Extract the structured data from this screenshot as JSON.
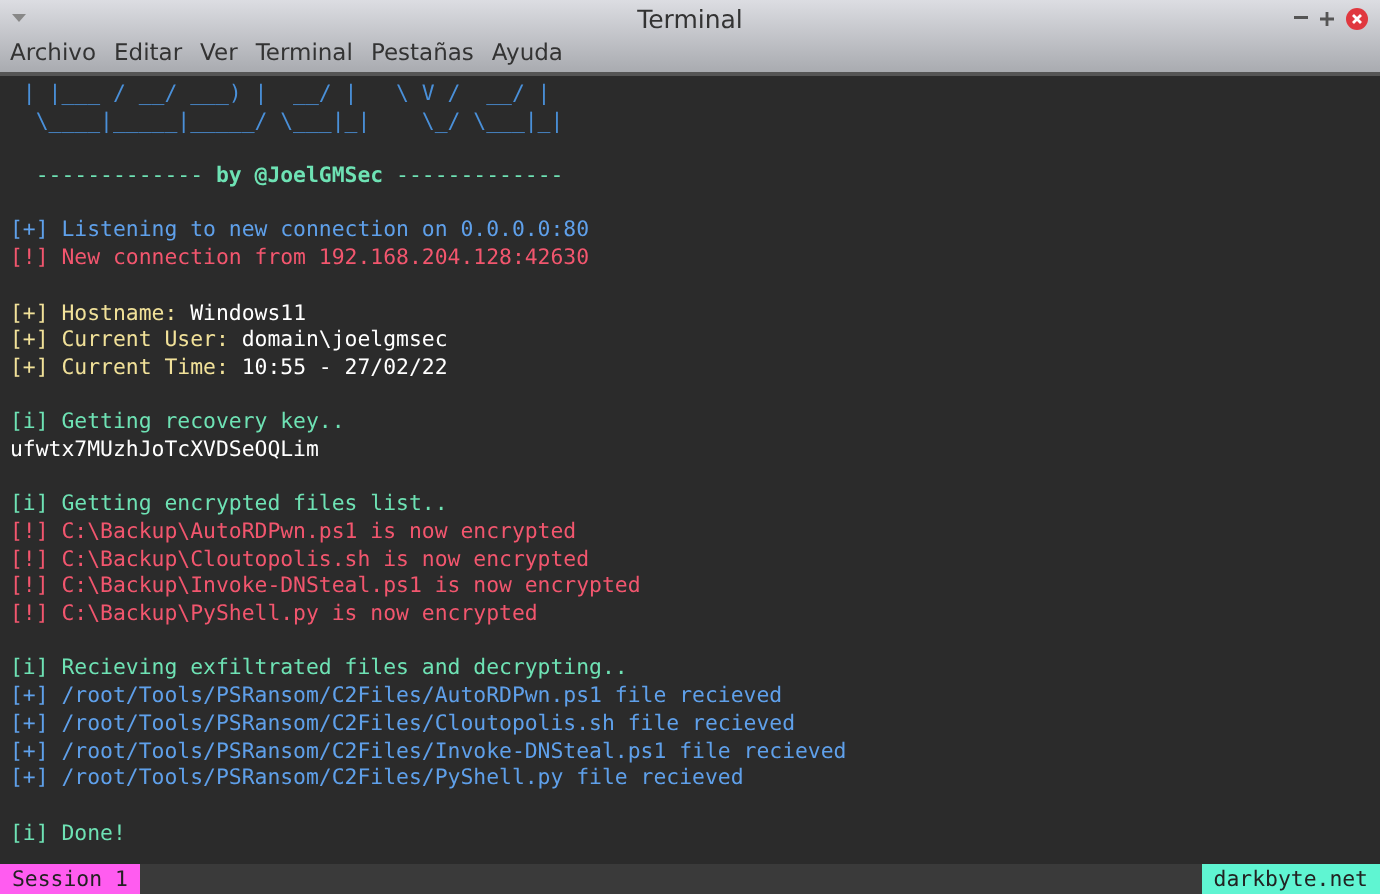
{
  "window": {
    "title": "Terminal"
  },
  "menu": [
    {
      "label": "Archivo"
    },
    {
      "label": "Editar"
    },
    {
      "label": "Ver"
    },
    {
      "label": "Terminal"
    },
    {
      "label": "Pestañas"
    },
    {
      "label": "Ayuda"
    }
  ],
  "terminal": {
    "lines": [
      {
        "kind": "text",
        "segments": [
          {
            "text": " | |___ / __/ ___) |  __/ |   \\ V /  __/ |",
            "color": "#4a90d9"
          }
        ]
      },
      {
        "kind": "text",
        "segments": [
          {
            "text": "  \\____|_____|_____/ \\___|_|    \\_/ \\___|_|",
            "color": "#4a90d9"
          }
        ]
      },
      {
        "kind": "blank"
      },
      {
        "kind": "text",
        "segments": [
          {
            "text": "  ------------- ",
            "color": "#6ee2b4"
          },
          {
            "text": "by @JoelGMSec",
            "color": "#6ee2b4",
            "bold": true
          },
          {
            "text": " -------------",
            "color": "#6ee2b4"
          }
        ]
      },
      {
        "kind": "blank"
      },
      {
        "kind": "text",
        "segments": [
          {
            "text": "[+] Listening to new connection on 0.0.0.0:80",
            "color": "#5fa0ea"
          }
        ]
      },
      {
        "kind": "text",
        "segments": [
          {
            "text": "[!] New connection from 192.168.204.128:42630",
            "color": "#f2566e"
          }
        ]
      },
      {
        "kind": "blank"
      },
      {
        "kind": "text",
        "segments": [
          {
            "text": "[+] Hostname: ",
            "color": "#f1e199"
          },
          {
            "text": "Windows11",
            "color": "#ffffff"
          }
        ]
      },
      {
        "kind": "text",
        "segments": [
          {
            "text": "[+] Current User: ",
            "color": "#f1e199"
          },
          {
            "text": "domain\\joelgmsec",
            "color": "#ffffff"
          }
        ]
      },
      {
        "kind": "text",
        "segments": [
          {
            "text": "[+] Current Time: ",
            "color": "#f1e199"
          },
          {
            "text": "10:55 - 27/02/22",
            "color": "#ffffff"
          }
        ]
      },
      {
        "kind": "blank"
      },
      {
        "kind": "text",
        "segments": [
          {
            "text": "[i] Getting recovery key..",
            "color": "#6ee2b4"
          }
        ]
      },
      {
        "kind": "text",
        "segments": [
          {
            "text": "ufwtx7MUzhJoTcXVDSeOQLim",
            "color": "#ffffff"
          }
        ]
      },
      {
        "kind": "blank"
      },
      {
        "kind": "text",
        "segments": [
          {
            "text": "[i] Getting encrypted files list..",
            "color": "#6ee2b4"
          }
        ]
      },
      {
        "kind": "text",
        "segments": [
          {
            "text": "[!] C:\\Backup\\AutoRDPwn.ps1 is now encrypted",
            "color": "#f2566e"
          }
        ]
      },
      {
        "kind": "text",
        "segments": [
          {
            "text": "[!] C:\\Backup\\Cloutopolis.sh is now encrypted",
            "color": "#f2566e"
          }
        ]
      },
      {
        "kind": "text",
        "segments": [
          {
            "text": "[!] C:\\Backup\\Invoke-DNSteal.ps1 is now encrypted",
            "color": "#f2566e"
          }
        ]
      },
      {
        "kind": "text",
        "segments": [
          {
            "text": "[!] C:\\Backup\\PyShell.py is now encrypted",
            "color": "#f2566e"
          }
        ]
      },
      {
        "kind": "blank"
      },
      {
        "kind": "text",
        "segments": [
          {
            "text": "[i] Recieving exfiltrated files and decrypting..",
            "color": "#6ee2b4"
          }
        ]
      },
      {
        "kind": "text",
        "segments": [
          {
            "text": "[+] /root/Tools/PSRansom/C2Files/AutoRDPwn.ps1 file recieved",
            "color": "#5fa0ea"
          }
        ]
      },
      {
        "kind": "text",
        "segments": [
          {
            "text": "[+] /root/Tools/PSRansom/C2Files/Cloutopolis.sh file recieved",
            "color": "#5fa0ea"
          }
        ]
      },
      {
        "kind": "text",
        "segments": [
          {
            "text": "[+] /root/Tools/PSRansom/C2Files/Invoke-DNSteal.ps1 file recieved",
            "color": "#5fa0ea"
          }
        ]
      },
      {
        "kind": "text",
        "segments": [
          {
            "text": "[+] /root/Tools/PSRansom/C2Files/PyShell.py file recieved",
            "color": "#5fa0ea"
          }
        ]
      },
      {
        "kind": "blank"
      },
      {
        "kind": "text",
        "segments": [
          {
            "text": "[i] Done!",
            "color": "#6ee2b4"
          }
        ]
      }
    ]
  },
  "status_bar": {
    "session": "Session 1",
    "host": "darkbyte.net"
  }
}
